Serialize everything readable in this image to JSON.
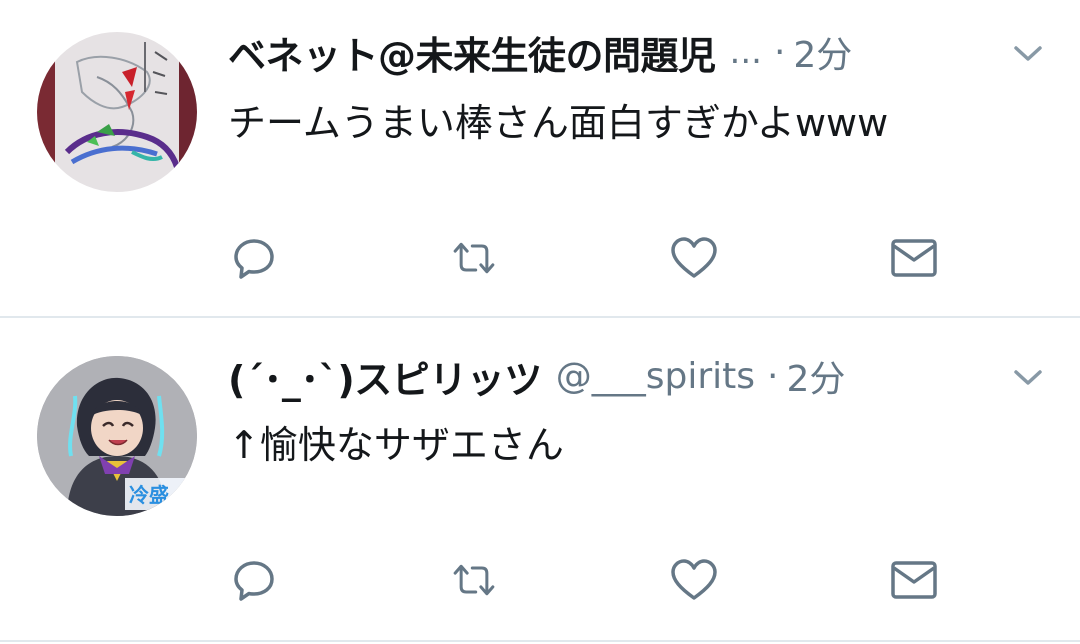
{
  "tweets": [
    {
      "display_name": "ベネット@未来生徒の問題児",
      "truncation": "...",
      "handle": "",
      "separator": "·",
      "time": "2分",
      "text": "チームうまい棒さん面白すぎかよwww",
      "avatar": "drawing-avatar"
    },
    {
      "display_name": "(´･_･`)スピリッツ",
      "truncation": "",
      "handle": "@___spirits",
      "separator": "·",
      "time": "2分",
      "text": "↑愉快なサザエさん",
      "avatar": "anime-character-avatar",
      "avatar_badge": "冷盛"
    }
  ],
  "actions": {
    "icons": [
      "reply-icon",
      "retweet-icon",
      "like-icon",
      "direct-message-icon"
    ]
  },
  "colors": {
    "name": "#14171a",
    "secondary": "#657786",
    "icon": "#657786",
    "divider": "#e1e8ed"
  }
}
